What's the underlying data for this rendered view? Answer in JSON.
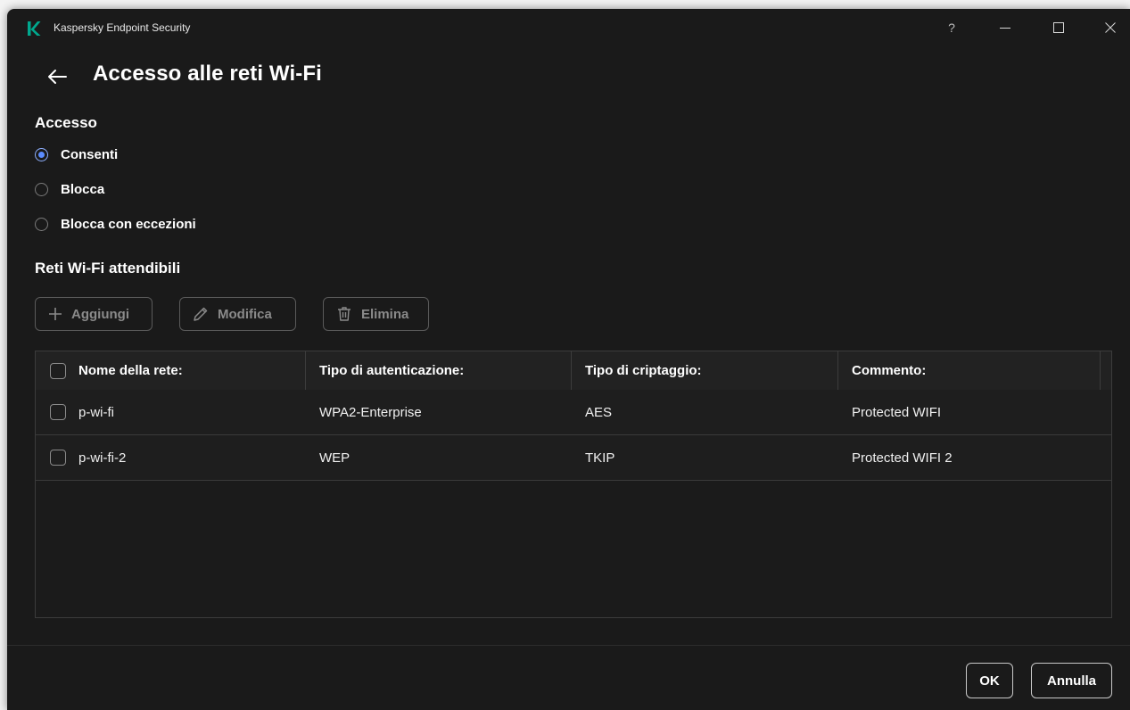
{
  "window": {
    "app_title": "Kaspersky Endpoint Security",
    "help": "?",
    "brand_color": "#00a88e"
  },
  "page": {
    "title": "Accesso alle reti Wi-Fi"
  },
  "access": {
    "section_title": "Accesso",
    "options": [
      {
        "label": "Consenti",
        "selected": true
      },
      {
        "label": "Blocca",
        "selected": false
      },
      {
        "label": "Blocca con eccezioni",
        "selected": false
      }
    ]
  },
  "trusted": {
    "section_title": "Reti Wi-Fi attendibili",
    "toolbar": {
      "add_label": "Aggiungi",
      "edit_label": "Modifica",
      "delete_label": "Elimina"
    },
    "columns": [
      "Nome della rete:",
      "Tipo di autenticazione:",
      "Tipo di criptaggio:",
      "Commento:"
    ],
    "rows": [
      {
        "name": "p-wi-fi",
        "auth": "WPA2-Enterprise",
        "encryption": "AES",
        "comment": "Protected WIFI"
      },
      {
        "name": "p-wi-fi-2",
        "auth": "WEP",
        "encryption": "TKIP",
        "comment": "Protected WIFI 2"
      }
    ]
  },
  "footer": {
    "ok_label": "OK",
    "cancel_label": "Annulla"
  }
}
